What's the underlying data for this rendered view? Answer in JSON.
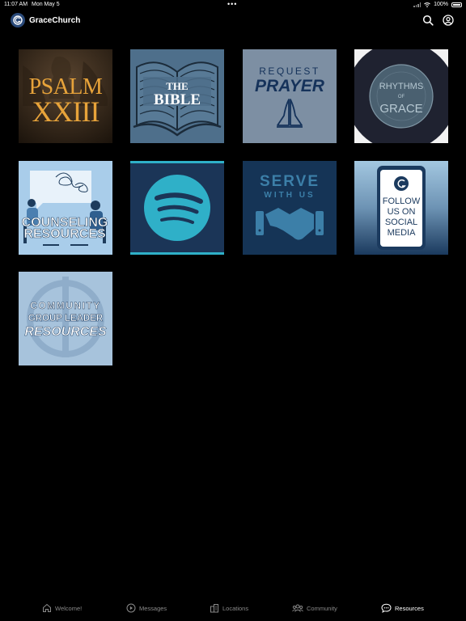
{
  "status_bar": {
    "time": "11:07 AM",
    "date": "Mon May 5",
    "battery": "100%"
  },
  "header": {
    "title": "GraceChurch",
    "logo_letter": "G"
  },
  "tiles": [
    {
      "name": "psalm-23-tile",
      "lines": [
        "PSALM",
        "XXIII"
      ]
    },
    {
      "name": "the-bible-tile",
      "lines": [
        "THE",
        "BIBLE"
      ]
    },
    {
      "name": "request-prayer-tile",
      "lines": [
        "REQUEST",
        "PRAYER"
      ]
    },
    {
      "name": "rhythms-of-grace-tile",
      "lines": [
        "RHYTHMS",
        "OF",
        "GRACE"
      ]
    },
    {
      "name": "counseling-resources-tile",
      "lines": [
        "COUNSELING",
        "RESOURCES"
      ]
    },
    {
      "name": "spotify-tile",
      "lines": []
    },
    {
      "name": "serve-with-us-tile",
      "lines": [
        "SERVE",
        "WITH US"
      ]
    },
    {
      "name": "follow-us-tile",
      "lines": [
        "FOLLOW",
        "US ON",
        "SOCIAL",
        "MEDIA"
      ]
    },
    {
      "name": "community-group-leader-resources-tile",
      "lines": [
        "COMMUNITY",
        "GROUP LEADER",
        "RESOURCES"
      ]
    }
  ],
  "tabs": [
    {
      "label": "Welcome!",
      "icon": "home-icon"
    },
    {
      "label": "Messages",
      "icon": "play-circle-icon"
    },
    {
      "label": "Locations",
      "icon": "building-icon"
    },
    {
      "label": "Community",
      "icon": "people-icon"
    },
    {
      "label": "Resources",
      "icon": "chat-bubble-icon",
      "active": true
    }
  ]
}
